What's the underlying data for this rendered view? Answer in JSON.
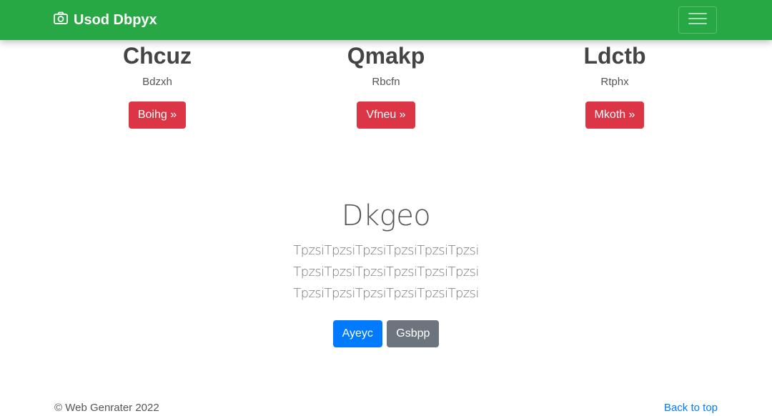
{
  "navbar": {
    "brand": "Usod Dbpyx",
    "brand_icon": "camera-icon",
    "toggler_icon": "hamburger-icon",
    "color": "#28a745"
  },
  "features": [
    {
      "title": "Chcuz",
      "text": "Bdzxh",
      "button": "Boihg »"
    },
    {
      "title": "Qmakp",
      "text": "Rbcfn",
      "button": "Vfneu »"
    },
    {
      "title": "Ldctb",
      "text": "Rtphx",
      "button": "Mkoth »"
    }
  ],
  "hero": {
    "title": "Dkgeo",
    "lead": "TpzsiTpzsiTpzsiTpzsiTpzsiTpzsi TpzsiTpzsiTpzsiTpzsiTpzsiTpzsi TpzsiTpzsiTpzsiTpzsiTpzsiTpzsi",
    "primary_button": "Ayeyc",
    "secondary_button": "Gsbpp"
  },
  "footer": {
    "copyright": "© Web Genrater 2022",
    "back_to_top": "Back to top"
  },
  "colors": {
    "danger": "#dc3545",
    "primary": "#007bff",
    "secondary": "#6c757d"
  }
}
